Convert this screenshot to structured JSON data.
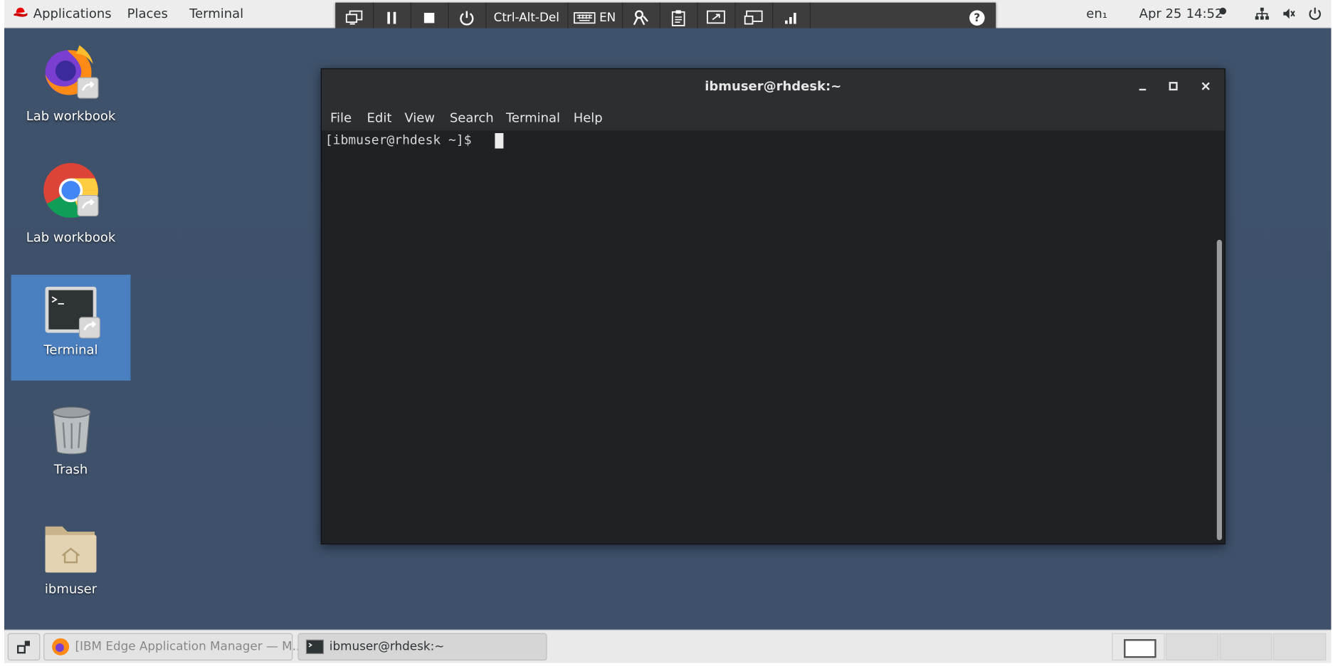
{
  "topbar": {
    "applications": "Applications",
    "places": "Places",
    "terminal": "Terminal",
    "input_source": "en₁",
    "date": "Apr 25",
    "time": "14:52"
  },
  "remote_toolbar": {
    "ctrl_alt_del": "Ctrl-Alt-Del",
    "keyboard_lang": "EN",
    "help": "?"
  },
  "desktop": {
    "icons": [
      {
        "label": "Lab workbook",
        "icon": "firefox-icon"
      },
      {
        "label": "Lab workbook",
        "icon": "chrome-icon"
      },
      {
        "label": "Terminal",
        "icon": "terminal-icon"
      },
      {
        "label": "Trash",
        "icon": "trash-icon"
      },
      {
        "label": "ibmuser",
        "icon": "home-folder-icon"
      }
    ]
  },
  "terminal_window": {
    "title": "ibmuser@rhdesk:~",
    "menu": [
      "File",
      "Edit",
      "View",
      "Search",
      "Terminal",
      "Help"
    ],
    "prompt": "[ibmuser@rhdesk ~]$ "
  },
  "taskbar": {
    "tasks": [
      {
        "label": "[IBM Edge Application Manager — M...",
        "icon": "firefox-icon"
      },
      {
        "label": "ibmuser@rhdesk:~",
        "icon": "terminal-icon"
      }
    ]
  },
  "colors": {
    "desktop_bg": "#3e506a",
    "selection": "#4a7fc0",
    "terminal_bg": "#1f2124",
    "titlebar": "#2c2e31"
  }
}
